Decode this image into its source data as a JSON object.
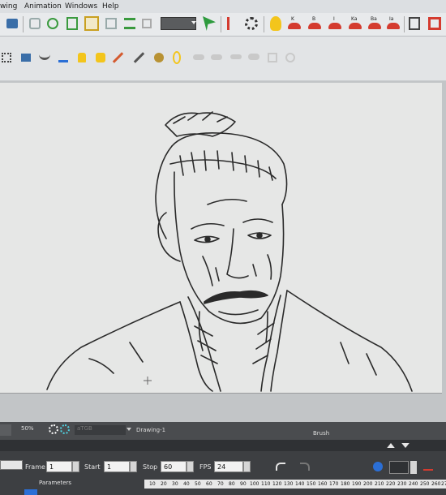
{
  "menu": {
    "items": [
      "wing",
      "Animation",
      "Windows",
      "Help"
    ]
  },
  "toolbar": {
    "icons": [
      "layout-icon",
      "paint-icon",
      "tree-icon",
      "bone-icon",
      "frame-icon",
      "deformer-icon",
      "flip-icon",
      "arrow-icon",
      "play-icon",
      "settings-icon",
      "light-icon",
      "k-icon",
      "b-icon",
      "i-icon",
      "ka-icon",
      "ba-icon",
      "ia-icon",
      "render-icon",
      "grid-icon"
    ],
    "key_labels": [
      "K",
      "B",
      "I",
      "Ka",
      "Ba",
      "Ia"
    ]
  },
  "status": {
    "zoom": "50%",
    "mode": "aTGB",
    "drawing_name": "Drawing-1",
    "tool": "Brush"
  },
  "timeline": {
    "frame_label": "Frame",
    "frame_value": "1",
    "start_label": "Start",
    "start_value": "1",
    "stop_label": "Stop",
    "stop_value": "60",
    "fps_label": "FPS",
    "fps_value": "24",
    "parameters_label": "Parameters",
    "ruler": [
      "10",
      "20",
      "30",
      "40",
      "50",
      "60",
      "70",
      "80",
      "90",
      "100",
      "110",
      "120",
      "130",
      "140",
      "150",
      "160",
      "170",
      "180",
      "190",
      "200",
      "210",
      "220",
      "230",
      "240",
      "250",
      "260",
      "27"
    ]
  },
  "colors": {
    "accent_green": "#2e9b3e",
    "accent_red": "#d43b2f",
    "accent_blue": "#2b6fd6"
  }
}
